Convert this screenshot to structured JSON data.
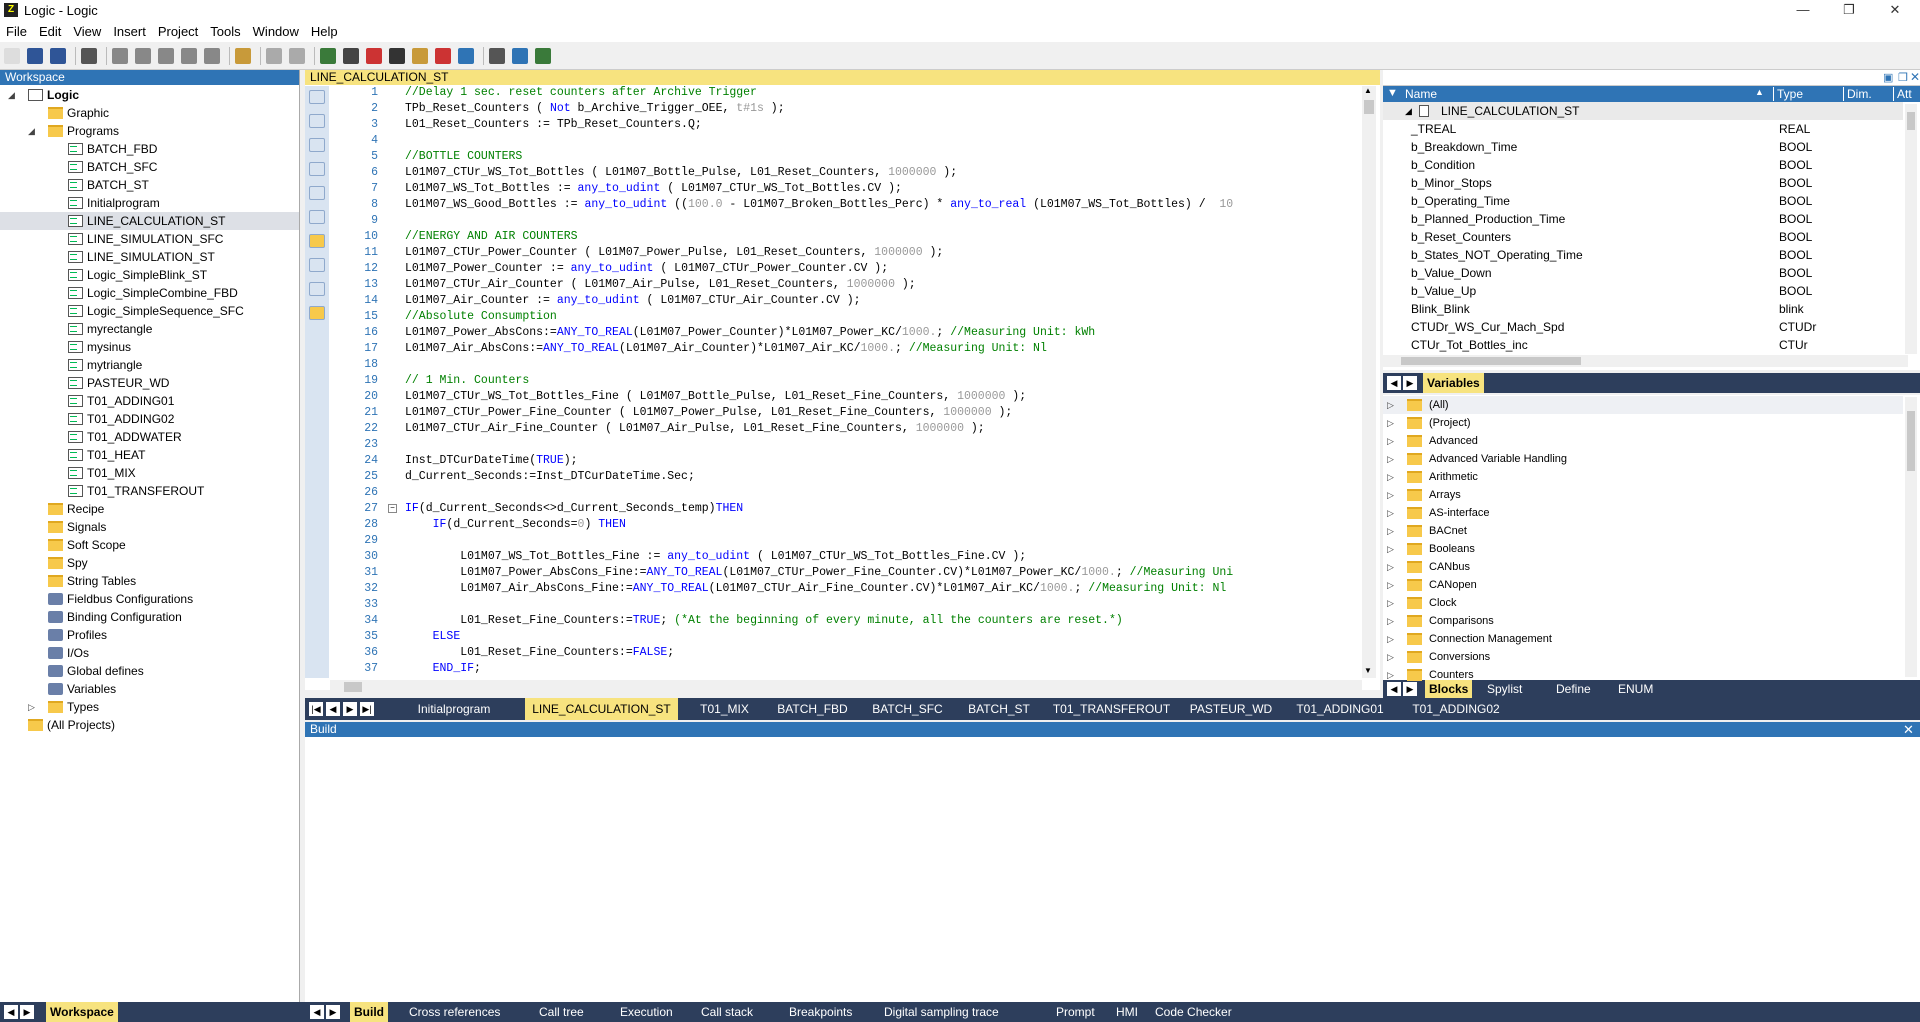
{
  "window": {
    "title": "Logic - Logic"
  },
  "menu": [
    "File",
    "Edit",
    "View",
    "Insert",
    "Project",
    "Tools",
    "Window",
    "Help"
  ],
  "workspace": {
    "header": "Workspace",
    "tab": "Workspace",
    "items": [
      {
        "label": "Logic",
        "type": "root",
        "depth": 0,
        "expanded": true,
        "bold": true
      },
      {
        "label": "Graphic",
        "type": "folder",
        "depth": 1
      },
      {
        "label": "Programs",
        "type": "folder",
        "depth": 1,
        "expanded": true
      },
      {
        "label": "BATCH_FBD",
        "type": "prog",
        "depth": 2
      },
      {
        "label": "BATCH_SFC",
        "type": "prog",
        "depth": 2
      },
      {
        "label": "BATCH_ST",
        "type": "prog",
        "depth": 2
      },
      {
        "label": "Initialprogram",
        "type": "prog",
        "depth": 2
      },
      {
        "label": "LINE_CALCULATION_ST",
        "type": "prog",
        "depth": 2,
        "selected": true
      },
      {
        "label": "LINE_SIMULATION_SFC",
        "type": "prog",
        "depth": 2
      },
      {
        "label": "LINE_SIMULATION_ST",
        "type": "prog",
        "depth": 2
      },
      {
        "label": "Logic_SimpleBlink_ST",
        "type": "prog",
        "depth": 2
      },
      {
        "label": "Logic_SimpleCombine_FBD",
        "type": "prog",
        "depth": 2
      },
      {
        "label": "Logic_SimpleSequence_SFC",
        "type": "prog",
        "depth": 2
      },
      {
        "label": "myrectangle",
        "type": "prog",
        "depth": 2
      },
      {
        "label": "mysinus",
        "type": "prog",
        "depth": 2
      },
      {
        "label": "mytriangle",
        "type": "prog",
        "depth": 2
      },
      {
        "label": "PASTEUR_WD",
        "type": "prog",
        "depth": 2
      },
      {
        "label": "T01_ADDING01",
        "type": "prog",
        "depth": 2
      },
      {
        "label": "T01_ADDING02",
        "type": "prog",
        "depth": 2
      },
      {
        "label": "T01_ADDWATER",
        "type": "prog",
        "depth": 2
      },
      {
        "label": "T01_HEAT",
        "type": "prog",
        "depth": 2
      },
      {
        "label": "T01_MIX",
        "type": "prog",
        "depth": 2
      },
      {
        "label": "T01_TRANSFEROUT",
        "type": "prog",
        "depth": 2
      },
      {
        "label": "Recipe",
        "type": "folder",
        "depth": 1
      },
      {
        "label": "Signals",
        "type": "folder",
        "depth": 1
      },
      {
        "label": "Soft Scope",
        "type": "folder",
        "depth": 1
      },
      {
        "label": "Spy",
        "type": "folder",
        "depth": 1
      },
      {
        "label": "String Tables",
        "type": "folder",
        "depth": 1
      },
      {
        "label": "Fieldbus Configurations",
        "type": "special",
        "depth": 1
      },
      {
        "label": "Binding Configuration",
        "type": "special",
        "depth": 1
      },
      {
        "label": "Profiles",
        "type": "special",
        "depth": 1
      },
      {
        "label": "I/Os",
        "type": "special",
        "depth": 1
      },
      {
        "label": "Global defines",
        "type": "special",
        "depth": 1
      },
      {
        "label": "Variables",
        "type": "special",
        "depth": 1
      },
      {
        "label": "Types",
        "type": "folder",
        "depth": 1,
        "collapsed": true
      },
      {
        "label": "(All Projects)",
        "type": "folder",
        "depth": 0
      }
    ]
  },
  "editor": {
    "title": "LINE_CALCULATION_ST",
    "lines": [
      {
        "n": "1",
        "segs": [
          [
            "cm",
            "//Delay 1 sec. reset counters after Archive Trigger"
          ]
        ]
      },
      {
        "n": "2",
        "segs": [
          [
            "t",
            "TPb_Reset_Counters ( "
          ],
          [
            "kw",
            "Not"
          ],
          [
            "t",
            " b_Archive_Trigger_OEE, "
          ],
          [
            "num",
            "t#1s"
          ],
          [
            "t",
            " );"
          ]
        ]
      },
      {
        "n": "3",
        "segs": [
          [
            "t",
            "L01_Reset_Counters := TPb_Reset_Counters.Q;"
          ]
        ]
      },
      {
        "n": "4",
        "segs": []
      },
      {
        "n": "5",
        "segs": [
          [
            "cm",
            "//BOTTLE COUNTERS"
          ]
        ]
      },
      {
        "n": "6",
        "segs": [
          [
            "t",
            "L01M07_CTUr_WS_Tot_Bottles ( L01M07_Bottle_Pulse, L01_Reset_Counters, "
          ],
          [
            "num",
            "1000000"
          ],
          [
            "t",
            " );"
          ]
        ]
      },
      {
        "n": "7",
        "segs": [
          [
            "t",
            "L01M07_WS_Tot_Bottles := "
          ],
          [
            "kw",
            "any_to_udint"
          ],
          [
            "t",
            " ( L01M07_CTUr_WS_Tot_Bottles.CV );"
          ]
        ]
      },
      {
        "n": "8",
        "segs": [
          [
            "t",
            "L01M07_WS_Good_Bottles := "
          ],
          [
            "kw",
            "any_to_udint"
          ],
          [
            "t",
            " (("
          ],
          [
            "num",
            "100.0"
          ],
          [
            "t",
            " - L01M07_Broken_Bottles_Perc) * "
          ],
          [
            "kw",
            "any_to_real"
          ],
          [
            "t",
            " (L01M07_WS_Tot_Bottles) /  "
          ],
          [
            "num",
            "10"
          ]
        ]
      },
      {
        "n": "9",
        "segs": []
      },
      {
        "n": "10",
        "segs": [
          [
            "cm",
            "//ENERGY AND AIR COUNTERS"
          ]
        ]
      },
      {
        "n": "11",
        "segs": [
          [
            "t",
            "L01M07_CTUr_Power_Counter ( L01M07_Power_Pulse, L01_Reset_Counters, "
          ],
          [
            "num",
            "1000000"
          ],
          [
            "t",
            " );"
          ]
        ]
      },
      {
        "n": "12",
        "segs": [
          [
            "t",
            "L01M07_Power_Counter := "
          ],
          [
            "kw",
            "any_to_udint"
          ],
          [
            "t",
            " ( L01M07_CTUr_Power_Counter.CV );"
          ]
        ]
      },
      {
        "n": "13",
        "segs": [
          [
            "t",
            "L01M07_CTUr_Air_Counter ( L01M07_Air_Pulse, L01_Reset_Counters, "
          ],
          [
            "num",
            "1000000"
          ],
          [
            "t",
            " );"
          ]
        ]
      },
      {
        "n": "14",
        "segs": [
          [
            "t",
            "L01M07_Air_Counter := "
          ],
          [
            "kw",
            "any_to_udint"
          ],
          [
            "t",
            " ( L01M07_CTUr_Air_Counter.CV );"
          ]
        ]
      },
      {
        "n": "15",
        "segs": [
          [
            "cm",
            "//Absolute Consumption"
          ]
        ]
      },
      {
        "n": "16",
        "segs": [
          [
            "t",
            "L01M07_Power_AbsCons:="
          ],
          [
            "kw",
            "ANY_TO_REAL"
          ],
          [
            "t",
            "(L01M07_Power_Counter)*L01M07_Power_KC/"
          ],
          [
            "num",
            "1000."
          ],
          [
            "t",
            "; "
          ],
          [
            "cm",
            "//Measuring Unit: kWh"
          ]
        ]
      },
      {
        "n": "17",
        "segs": [
          [
            "t",
            "L01M07_Air_AbsCons:="
          ],
          [
            "kw",
            "ANY_TO_REAL"
          ],
          [
            "t",
            "(L01M07_Air_Counter)*L01M07_Air_KC/"
          ],
          [
            "num",
            "1000."
          ],
          [
            "t",
            "; "
          ],
          [
            "cm",
            "//Measuring Unit: Nl"
          ]
        ]
      },
      {
        "n": "18",
        "segs": []
      },
      {
        "n": "19",
        "segs": [
          [
            "cm",
            "// 1 Min. Counters"
          ]
        ]
      },
      {
        "n": "20",
        "segs": [
          [
            "t",
            "L01M07_CTUr_WS_Tot_Bottles_Fine ( L01M07_Bottle_Pulse, L01_Reset_Fine_Counters, "
          ],
          [
            "num",
            "1000000"
          ],
          [
            "t",
            " );"
          ]
        ]
      },
      {
        "n": "21",
        "segs": [
          [
            "t",
            "L01M07_CTUr_Power_Fine_Counter ( L01M07_Power_Pulse, L01_Reset_Fine_Counters, "
          ],
          [
            "num",
            "1000000"
          ],
          [
            "t",
            " );"
          ]
        ]
      },
      {
        "n": "22",
        "segs": [
          [
            "t",
            "L01M07_CTUr_Air_Fine_Counter ( L01M07_Air_Pulse, L01_Reset_Fine_Counters, "
          ],
          [
            "num",
            "1000000"
          ],
          [
            "t",
            " );"
          ]
        ]
      },
      {
        "n": "23",
        "segs": []
      },
      {
        "n": "24",
        "segs": [
          [
            "t",
            "Inst_DTCurDateTime("
          ],
          [
            "kw",
            "TRUE"
          ],
          [
            "t",
            ");"
          ]
        ]
      },
      {
        "n": "25",
        "segs": [
          [
            "t",
            "d_Current_Seconds:=Inst_DTCurDateTime.Sec;"
          ]
        ]
      },
      {
        "n": "26",
        "segs": []
      },
      {
        "n": "27",
        "segs": [
          [
            "kw",
            "IF"
          ],
          [
            "t",
            "(d_Current_Seconds<>d_Current_Seconds_temp)"
          ],
          [
            "kw",
            "THEN"
          ]
        ]
      },
      {
        "n": "28",
        "segs": [
          [
            "t",
            "    "
          ],
          [
            "kw",
            "IF"
          ],
          [
            "t",
            "(d_Current_Seconds="
          ],
          [
            "num",
            "0"
          ],
          [
            "t",
            ") "
          ],
          [
            "kw",
            "THEN"
          ]
        ]
      },
      {
        "n": "29",
        "segs": []
      },
      {
        "n": "30",
        "segs": [
          [
            "t",
            "        L01M07_WS_Tot_Bottles_Fine := "
          ],
          [
            "kw",
            "any_to_udint"
          ],
          [
            "t",
            " ( L01M07_CTUr_WS_Tot_Bottles_Fine.CV );"
          ]
        ]
      },
      {
        "n": "31",
        "segs": [
          [
            "t",
            "        L01M07_Power_AbsCons_Fine:="
          ],
          [
            "kw",
            "ANY_TO_REAL"
          ],
          [
            "t",
            "(L01M07_CTUr_Power_Fine_Counter.CV)*L01M07_Power_KC/"
          ],
          [
            "num",
            "1000."
          ],
          [
            "t",
            "; "
          ],
          [
            "cm",
            "//Measuring Uni"
          ]
        ]
      },
      {
        "n": "32",
        "segs": [
          [
            "t",
            "        L01M07_Air_AbsCons_Fine:="
          ],
          [
            "kw",
            "ANY_TO_REAL"
          ],
          [
            "t",
            "(L01M07_CTUr_Air_Fine_Counter.CV)*L01M07_Air_KC/"
          ],
          [
            "num",
            "1000."
          ],
          [
            "t",
            "; "
          ],
          [
            "cm",
            "//Measuring Unit: Nl"
          ]
        ]
      },
      {
        "n": "33",
        "segs": []
      },
      {
        "n": "34",
        "segs": [
          [
            "t",
            "        L01_Reset_Fine_Counters:="
          ],
          [
            "kw",
            "TRUE"
          ],
          [
            "t",
            "; "
          ],
          [
            "cm",
            "(*At the beginning of every minute, all the counters are reset.*)"
          ]
        ]
      },
      {
        "n": "35",
        "segs": [
          [
            "t",
            "    "
          ],
          [
            "kw",
            "ELSE"
          ]
        ]
      },
      {
        "n": "36",
        "segs": [
          [
            "t",
            "        L01_Reset_Fine_Counters:="
          ],
          [
            "kw",
            "FALSE"
          ],
          [
            "t",
            ";"
          ]
        ]
      },
      {
        "n": "37",
        "segs": [
          [
            "t",
            "    "
          ],
          [
            "kw",
            "END_IF"
          ],
          [
            "t",
            ";"
          ]
        ]
      }
    ]
  },
  "editor_tabs": [
    "Initialprogram",
    "LINE_CALCULATION_ST",
    "T01_MIX",
    "BATCH_FBD",
    "BATCH_SFC",
    "BATCH_ST",
    "T01_TRANSFEROUT",
    "PASTEUR_WD",
    "T01_ADDING01",
    "T01_ADDING02"
  ],
  "editor_tab_active": "LINE_CALCULATION_ST",
  "vars": {
    "headers": {
      "name": "Name",
      "type": "Type",
      "dim": "Dim.",
      "attr": "Att"
    },
    "root": "LINE_CALCULATION_ST",
    "rows": [
      [
        "_TREAL",
        "REAL"
      ],
      [
        "b_Breakdown_Time",
        "BOOL"
      ],
      [
        "b_Condition",
        "BOOL"
      ],
      [
        "b_Minor_Stops",
        "BOOL"
      ],
      [
        "b_Operating_Time",
        "BOOL"
      ],
      [
        "b_Planned_Production_Time",
        "BOOL"
      ],
      [
        "b_Reset_Counters",
        "BOOL"
      ],
      [
        "b_States_NOT_Operating_Time",
        "BOOL"
      ],
      [
        "b_Value_Down",
        "BOOL"
      ],
      [
        "b_Value_Up",
        "BOOL"
      ],
      [
        "Blink_Blink",
        "blink"
      ],
      [
        "CTUDr_WS_Cur_Mach_Spd",
        "CTUDr"
      ],
      [
        "CTUr_Tot_Bottles_inc",
        "CTUr"
      ]
    ],
    "tab": "Variables"
  },
  "library": {
    "items": [
      "(All)",
      "(Project)",
      "Advanced",
      "Advanced Variable Handling",
      "Arithmetic",
      "Arrays",
      "AS-interface",
      "BACnet",
      "Booleans",
      "CANbus",
      "CANopen",
      "Clock",
      "Comparisons",
      "Connection Management",
      "Conversions",
      "Counters"
    ],
    "tabs": [
      "Blocks",
      "Spylist",
      "Define",
      "ENUM"
    ],
    "active": "Blocks"
  },
  "build": {
    "header": "Build"
  },
  "bottom_tabs": [
    "Build",
    "Cross references",
    "Call tree",
    "Execution",
    "Call stack",
    "Breakpoints",
    "Digital sampling trace",
    "Prompt",
    "HMI",
    "Code Checker"
  ],
  "bottom_active": "Build"
}
